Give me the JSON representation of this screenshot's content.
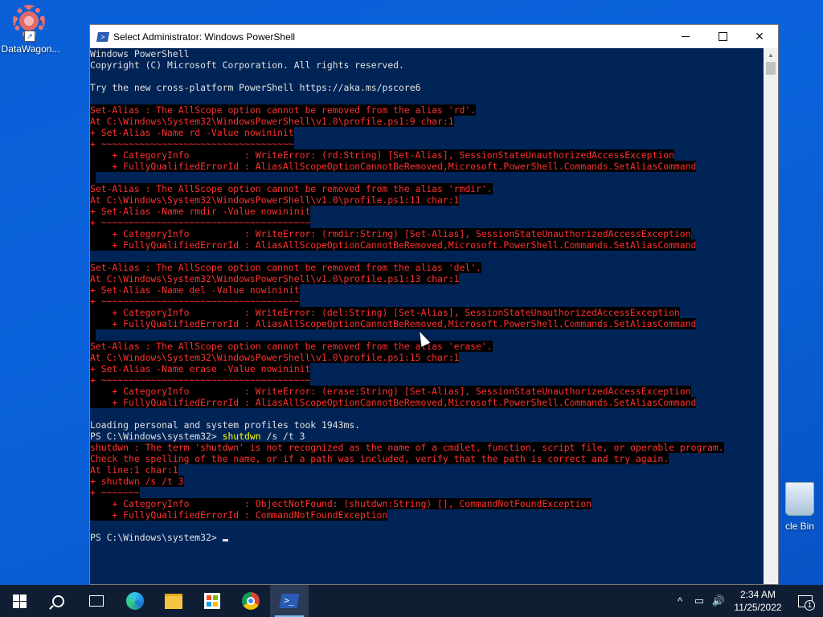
{
  "desktop": {
    "icons": [
      {
        "label": "DataWagon...",
        "icon": "gear-icon"
      },
      {
        "label": "cle Bin",
        "icon": "recycle-bin-icon"
      }
    ]
  },
  "window": {
    "title": "Select Administrator: Windows PowerShell",
    "minimize": "minimize",
    "maximize": "maximize",
    "close": "✕"
  },
  "console": {
    "lines": [
      {
        "type": "normal",
        "text": "Windows PowerShell"
      },
      {
        "type": "normal",
        "text": "Copyright (C) Microsoft Corporation. All rights reserved."
      },
      {
        "type": "normal",
        "text": ""
      },
      {
        "type": "normal",
        "text": "Try the new cross-platform PowerShell https://aka.ms/pscore6"
      },
      {
        "type": "normal",
        "text": ""
      },
      {
        "type": "error",
        "text": "Set-Alias : The AllScope option cannot be removed from the alias 'rd'."
      },
      {
        "type": "error",
        "text": "At C:\\Windows\\System32\\WindowsPowerShell\\v1.0\\profile.ps1:9 char:1"
      },
      {
        "type": "error",
        "text": "+ Set-Alias -Name rd -Value nowininit"
      },
      {
        "type": "error",
        "text": "+ ~~~~~~~~~~~~~~~~~~~~~~~~~~~~~~~~~~~"
      },
      {
        "type": "error",
        "text": "    + CategoryInfo          : WriteError: (rd:String) [Set-Alias], SessionStateUnauthorizedAccessException"
      },
      {
        "type": "error",
        "text": "    + FullyQualifiedErrorId : AliasAllScopeOptionCannotBeRemoved,Microsoft.PowerShell.Commands.SetAliasCommand"
      },
      {
        "type": "error",
        "text": " "
      },
      {
        "type": "error",
        "text": "Set-Alias : The AllScope option cannot be removed from the alias 'rmdir'."
      },
      {
        "type": "error",
        "text": "At C:\\Windows\\System32\\WindowsPowerShell\\v1.0\\profile.ps1:11 char:1"
      },
      {
        "type": "error",
        "text": "+ Set-Alias -Name rmdir -Value nowininit"
      },
      {
        "type": "error",
        "text": "+ ~~~~~~~~~~~~~~~~~~~~~~~~~~~~~~~~~~~~~~"
      },
      {
        "type": "error",
        "text": "    + CategoryInfo          : WriteError: (rmdir:String) [Set-Alias], SessionStateUnauthorizedAccessException"
      },
      {
        "type": "error",
        "text": "    + FullyQualifiedErrorId : AliasAllScopeOptionCannotBeRemoved,Microsoft.PowerShell.Commands.SetAliasCommand"
      },
      {
        "type": "normal",
        "text": ""
      },
      {
        "type": "error",
        "text": "Set-Alias : The AllScope option cannot be removed from the alias 'del'."
      },
      {
        "type": "error",
        "text": "At C:\\Windows\\System32\\WindowsPowerShell\\v1.0\\profile.ps1:13 char:1"
      },
      {
        "type": "error",
        "text": "+ Set-Alias -Name del -Value nowininit"
      },
      {
        "type": "error",
        "text": "+ ~~~~~~~~~~~~~~~~~~~~~~~~~~~~~~~~~~~~"
      },
      {
        "type": "error",
        "text": "    + CategoryInfo          : WriteError: (del:String) [Set-Alias], SessionStateUnauthorizedAccessException"
      },
      {
        "type": "error",
        "text": "    + FullyQualifiedErrorId : AliasAllScopeOptionCannotBeRemoved,Microsoft.PowerShell.Commands.SetAliasCommand"
      },
      {
        "type": "error",
        "text": " "
      },
      {
        "type": "error",
        "text": "Set-Alias : The AllScope option cannot be removed from the alias 'erase'."
      },
      {
        "type": "error",
        "text": "At C:\\Windows\\System32\\WindowsPowerShell\\v1.0\\profile.ps1:15 char:1"
      },
      {
        "type": "error",
        "text": "+ Set-Alias -Name erase -Value nowininit"
      },
      {
        "type": "error",
        "text": "+ ~~~~~~~~~~~~~~~~~~~~~~~~~~~~~~~~~~~~~~"
      },
      {
        "type": "error",
        "text": "    + CategoryInfo          : WriteError: (erase:String) [Set-Alias], SessionStateUnauthorizedAccessException"
      },
      {
        "type": "error",
        "text": "    + FullyQualifiedErrorId : AliasAllScopeOptionCannotBeRemoved,Microsoft.PowerShell.Commands.SetAliasCommand"
      },
      {
        "type": "normal",
        "text": ""
      },
      {
        "type": "normal",
        "text": "Loading personal and system profiles took 1943ms."
      },
      {
        "type": "prompt",
        "text": "PS C:\\Windows\\system32> ",
        "cmd": "shutdwn",
        "args": " /s /t 3"
      },
      {
        "type": "error",
        "text": "shutdwn : The term 'shutdwn' is not recognized as the name of a cmdlet, function, script file, or operable program."
      },
      {
        "type": "error",
        "text": "Check the spelling of the name, or if a path was included, verify that the path is correct and try again."
      },
      {
        "type": "error",
        "text": "At line:1 char:1"
      },
      {
        "type": "error",
        "text": "+ shutdwn /s /t 3"
      },
      {
        "type": "error",
        "text": "+ ~~~~~~~"
      },
      {
        "type": "error",
        "text": "    + CategoryInfo          : ObjectNotFound: (shutdwn:String) [], CommandNotFoundException"
      },
      {
        "type": "error",
        "text": "    + FullyQualifiedErrorId : CommandNotFoundException"
      },
      {
        "type": "normal",
        "text": ""
      },
      {
        "type": "prompt",
        "text": "PS C:\\Windows\\system32> ",
        "cmd": "",
        "args": "",
        "cursor": true
      }
    ]
  },
  "taskbar": {
    "items": [
      {
        "name": "start-button",
        "icon": "windows-logo-icon"
      },
      {
        "name": "search-button",
        "icon": "search-icon"
      },
      {
        "name": "task-view-button",
        "icon": "task-view-icon"
      },
      {
        "name": "edge-button",
        "icon": "edge-icon"
      },
      {
        "name": "file-explorer-button",
        "icon": "folder-icon"
      },
      {
        "name": "store-button",
        "icon": "store-icon"
      },
      {
        "name": "chrome-button",
        "icon": "chrome-icon"
      },
      {
        "name": "powershell-button",
        "icon": "powershell-icon",
        "active": true
      }
    ],
    "tray": {
      "chevron": "^",
      "network": "▭",
      "volume": "🔊"
    },
    "clock": {
      "time": "2:34 AM",
      "date": "11/25/2022"
    },
    "notifications": {
      "count": "1"
    }
  }
}
